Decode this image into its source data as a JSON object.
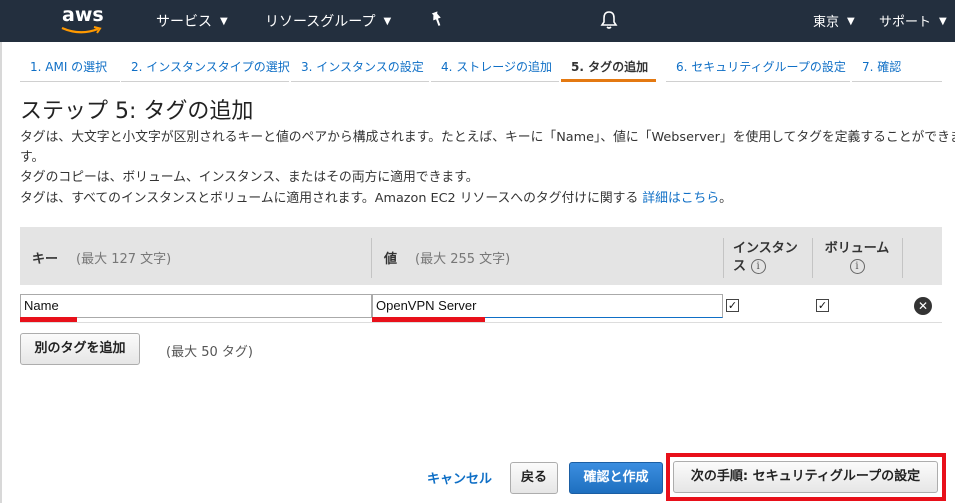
{
  "topnav": {
    "logo": "aws",
    "services": "サービス",
    "resource_groups": "リソースグループ",
    "region": "東京",
    "support": "サポート",
    "icons": [
      "pin-icon",
      "bell-icon"
    ]
  },
  "steps": [
    {
      "label": "1. AMI の選択"
    },
    {
      "label": "2. インスタンスタイプの選択"
    },
    {
      "label": "3. インスタンスの設定"
    },
    {
      "label": "4. ストレージの追加"
    },
    {
      "label": "5. タグの追加"
    },
    {
      "label": "6. セキュリティグループの設定"
    },
    {
      "label": "7. 確認"
    }
  ],
  "page": {
    "title": "ステップ 5: タグの追加",
    "desc1a": "タグは、大文字と小文字が区別されるキーと値のペアから構成されます。たとえば、キーに「Name」、値に「Webserver」を使用してタグを定義することができま",
    "desc1b": "す。",
    "desc2": "タグのコピーは、ボリューム、インスタンス、またはその両方に適用できます。",
    "desc3": "タグは、すべてのインスタンスとボリュームに適用されます。Amazon EC2 リソースへのタグ付けに関する ",
    "link": "詳細はこちら",
    "link_suffix": "。"
  },
  "table": {
    "key_header": "キー",
    "key_hint": "(最大 127 文字)",
    "value_header": "値",
    "value_hint": "(最大 255 文字)",
    "instance_header_1": "インスタン",
    "instance_header_2": "ス",
    "volume_header": "ボリューム",
    "info_glyph": "i",
    "rows": [
      {
        "key": "Name",
        "value": "OpenVPN Server",
        "instances": true,
        "volumes": true
      }
    ],
    "check_glyph": "✓",
    "remove_glyph": "✕"
  },
  "add_tag_button": "別のタグを追加",
  "max_tags": "(最大 50 タグ)",
  "footer": {
    "cancel": "キャンセル",
    "back": "戻る",
    "review": "確認と作成",
    "next": "次の手順: セキュリティグループの設定"
  },
  "colors": {
    "nav_bg": "#232f3e",
    "link": "#0f6fc6",
    "active_step": "#e47911",
    "highlight": "#e8101a",
    "primary_button": "#1e6fbf"
  }
}
